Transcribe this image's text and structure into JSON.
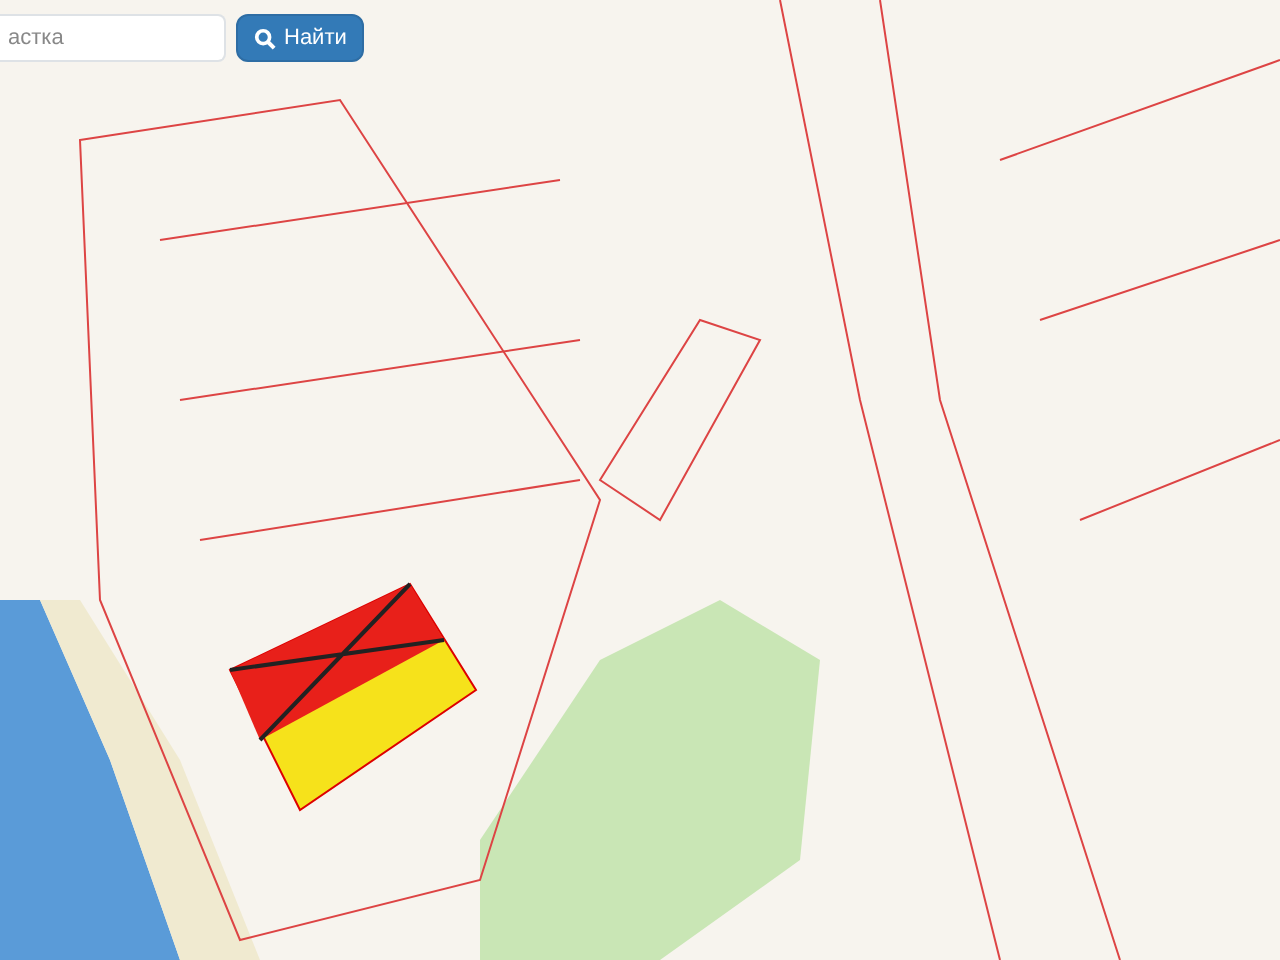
{
  "search": {
    "placeholder": "астка",
    "button": "Найти"
  }
}
